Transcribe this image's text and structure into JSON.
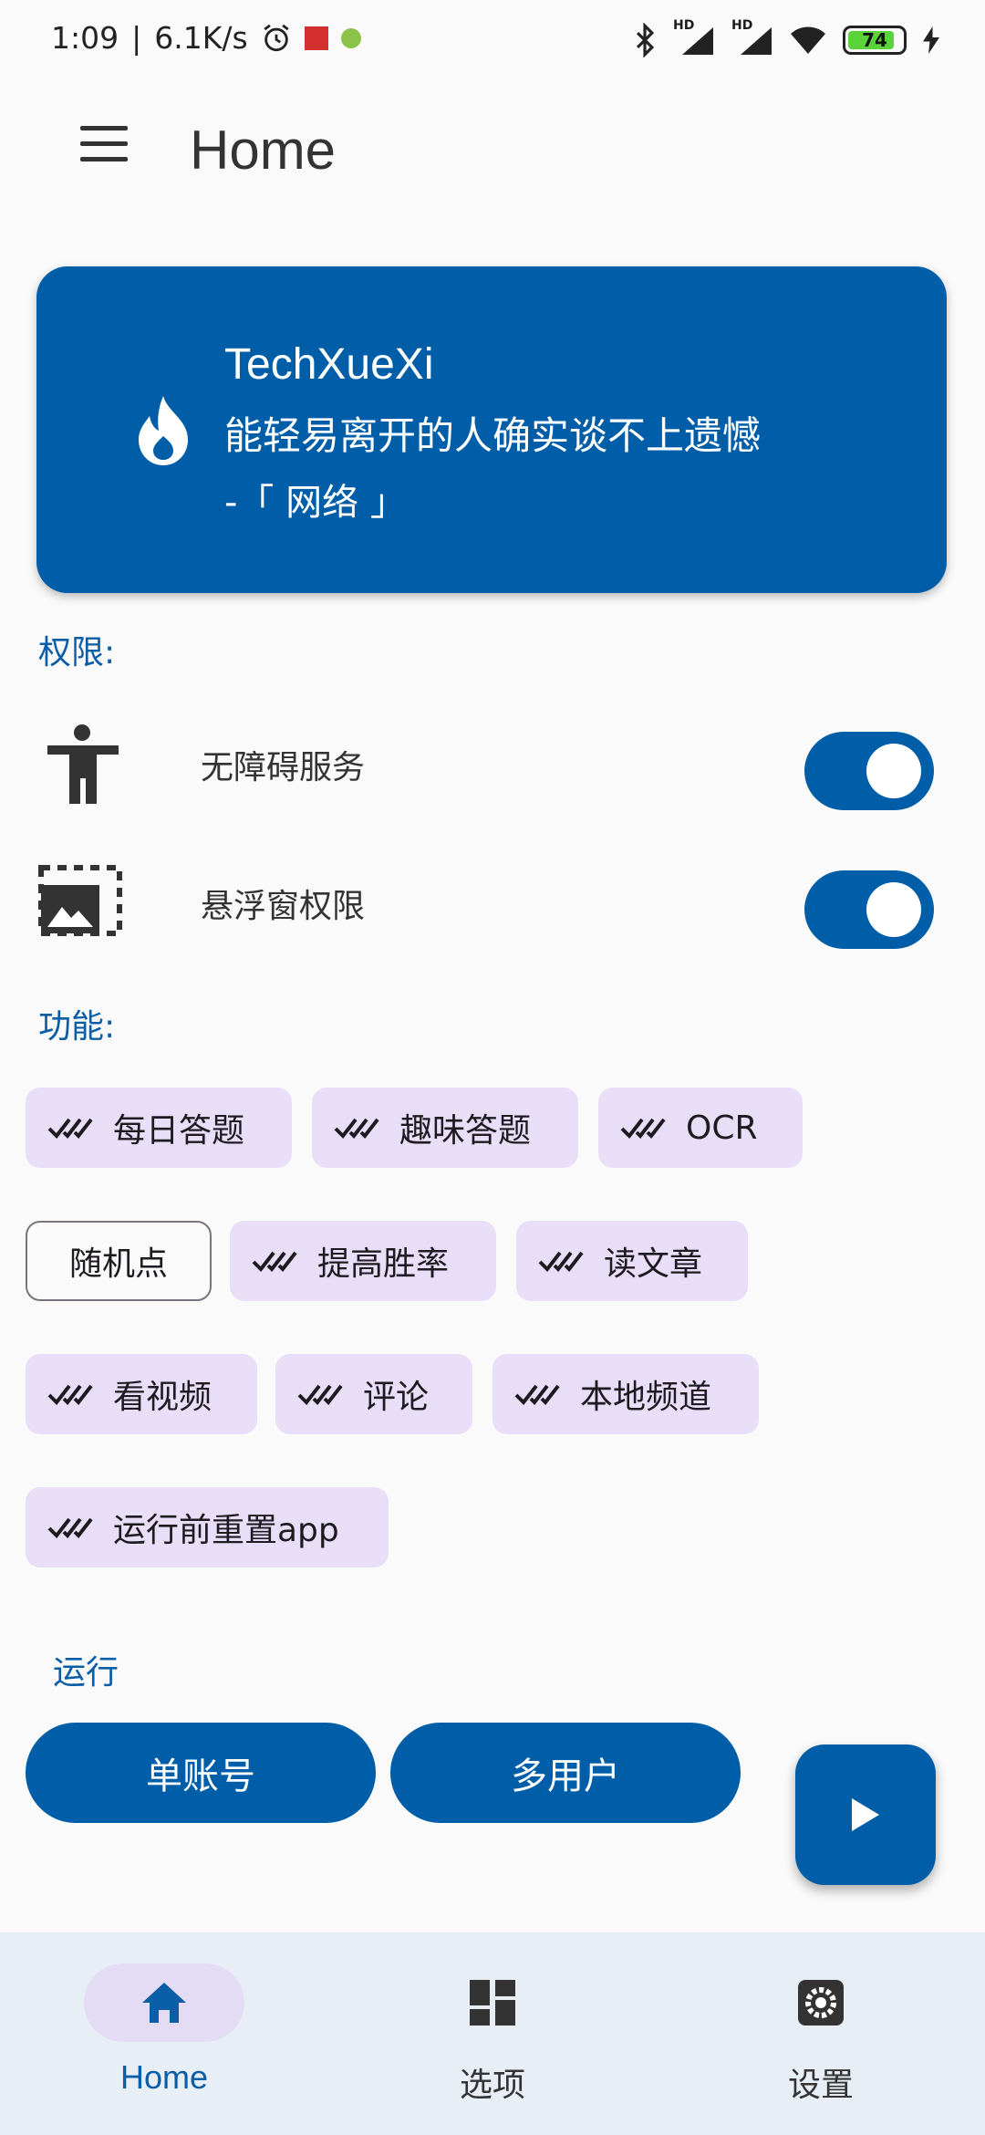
{
  "status_bar": {
    "time": "1:09",
    "network_speed": "6.1K/s",
    "battery": "74",
    "signal_1_label": "HD",
    "signal_2_label": "HD"
  },
  "app_bar": {
    "title": "Home"
  },
  "quote": {
    "name": "TechXueXi",
    "text": "能轻易离开的人确实谈不上遗憾",
    "source": "-「 网络 」"
  },
  "permissions": {
    "heading": "权限:",
    "items": [
      {
        "label": "无障碍服务",
        "enabled": true
      },
      {
        "label": "悬浮窗权限",
        "enabled": true
      }
    ]
  },
  "features": {
    "heading": "功能:",
    "chips": [
      {
        "label": "每日答题",
        "selected": true
      },
      {
        "label": "趣味答题",
        "selected": true
      },
      {
        "label": "OCR",
        "selected": true
      },
      {
        "label": "随机点",
        "selected": false
      },
      {
        "label": "提高胜率",
        "selected": true
      },
      {
        "label": "读文章",
        "selected": true
      },
      {
        "label": "看视频",
        "selected": true
      },
      {
        "label": "评论",
        "selected": true
      },
      {
        "label": "本地频道",
        "selected": true
      },
      {
        "label": "运行前重置app",
        "selected": true
      }
    ]
  },
  "run": {
    "heading": "运行",
    "single_account": "单账号",
    "multi_user": "多用户"
  },
  "bottom_nav": {
    "items": [
      {
        "label": "Home",
        "icon": "home-icon",
        "active": true
      },
      {
        "label": "选项",
        "icon": "dashboard-icon",
        "active": false
      },
      {
        "label": "设置",
        "icon": "settings-icon",
        "active": false
      }
    ]
  },
  "colors": {
    "primary": "#005ea8",
    "chip_bg": "#e8def8",
    "nav_bg": "#e8eef6"
  }
}
